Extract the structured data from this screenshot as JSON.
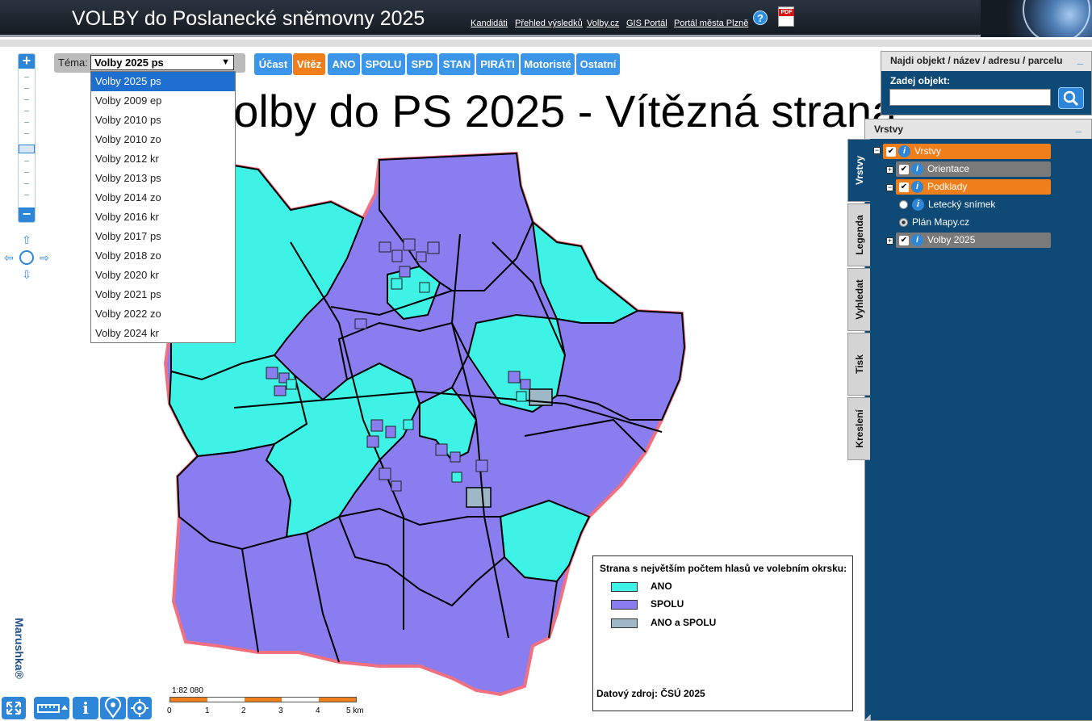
{
  "header": {
    "title": "VOLBY do Poslanecké sněmovny 2025",
    "links": [
      "Kandidáti",
      "Přehled výsledků",
      "Volby.cz",
      "GIS Portál",
      "Portál města Plzně"
    ],
    "help_icon": "?",
    "pdf_badge": "PDF"
  },
  "map": {
    "title": "Volby do PS 2025 - Vítězná strana",
    "zoom_in": "+",
    "zoom_out": "−",
    "colors": {
      "ano": "#3ff2e6",
      "spolu": "#8a7df0",
      "tie": "#9fb8c8",
      "boundary": "#f07080"
    }
  },
  "theme": {
    "label": "Téma:",
    "selected": "Volby 2025 ps",
    "options": [
      "Volby 2025 ps",
      "Volby 2009 ep",
      "Volby 2010 ps",
      "Volby 2010 zo",
      "Volby 2012 kr",
      "Volby 2013 ps",
      "Volby 2014 zo",
      "Volby 2016 kr",
      "Volby 2017 ps",
      "Volby 2018 zo",
      "Volby 2020 kr",
      "Volby 2021 ps",
      "Volby 2022 zo",
      "Volby 2024 kr"
    ]
  },
  "party_buttons": [
    "Účast",
    "Vítěz",
    "ANO",
    "SPOLU",
    "SPD",
    "STAN",
    "PIRÁTI",
    "Motoristé",
    "Ostatní"
  ],
  "active_party_button": "Vítěz",
  "search": {
    "header": "Najdi objekt / název / adresu / parcelu",
    "minimize": "_",
    "label": "Zadej objekt:",
    "value": ""
  },
  "layers_panel": {
    "header": "Vrstvy",
    "minimize": "_",
    "tabs": [
      "Vrstvy",
      "Legenda",
      "Vyhledat",
      "Tisk",
      "Kreslení"
    ],
    "tree": {
      "root": "Vrstvy",
      "orientace": "Orientace",
      "podklady": "Podklady",
      "letecky": "Letecký snímek",
      "plan": "Plán Mapy.cz",
      "volby": "Volby 2025"
    }
  },
  "legend": {
    "title": "Strana s největším počtem hlasů ve  volebním okrsku:",
    "items": [
      {
        "label": "ANO",
        "color": "#3ff2e6"
      },
      {
        "label": "SPOLU",
        "color": "#8a7df0"
      },
      {
        "label": "ANO a SPOLU",
        "color": "#9fb8c8"
      }
    ],
    "source": "Datový zdroj: ČSÚ 2025"
  },
  "scale": {
    "ratio": "1:82 080",
    "labels": [
      "0",
      "1",
      "2",
      "3",
      "4",
      "5 km"
    ]
  },
  "brand": "Marushka®",
  "tools": [
    "fullscreen-icon",
    "measure-icon",
    "info-icon",
    "gps-icon",
    "locate-icon"
  ]
}
